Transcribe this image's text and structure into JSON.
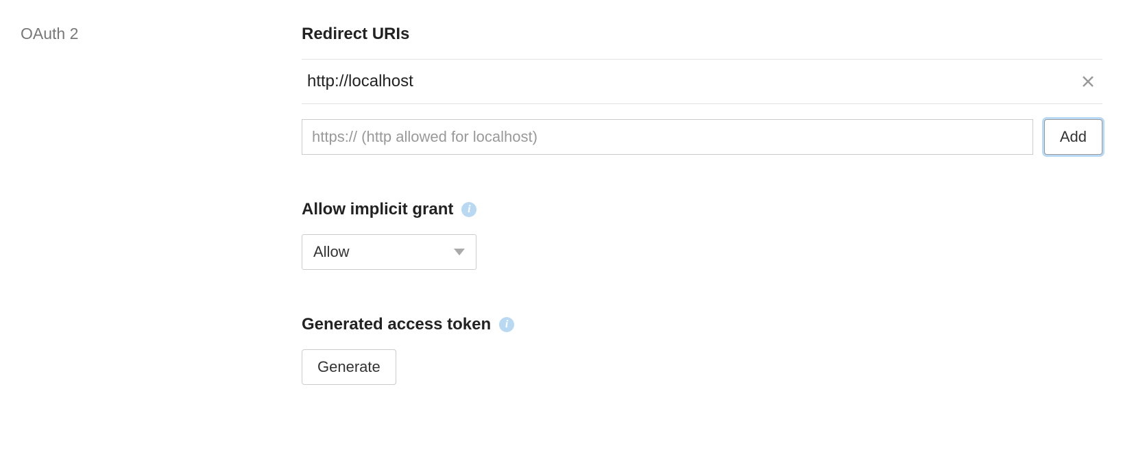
{
  "sidebar": {
    "label": "OAuth 2"
  },
  "redirect": {
    "heading": "Redirect URIs",
    "uris": [
      {
        "value": "http://localhost"
      }
    ],
    "input_placeholder": "https:// (http allowed for localhost)",
    "add_label": "Add"
  },
  "implicit_grant": {
    "heading": "Allow implicit grant",
    "selected": "Allow"
  },
  "access_token": {
    "heading": "Generated access token",
    "generate_label": "Generate"
  }
}
